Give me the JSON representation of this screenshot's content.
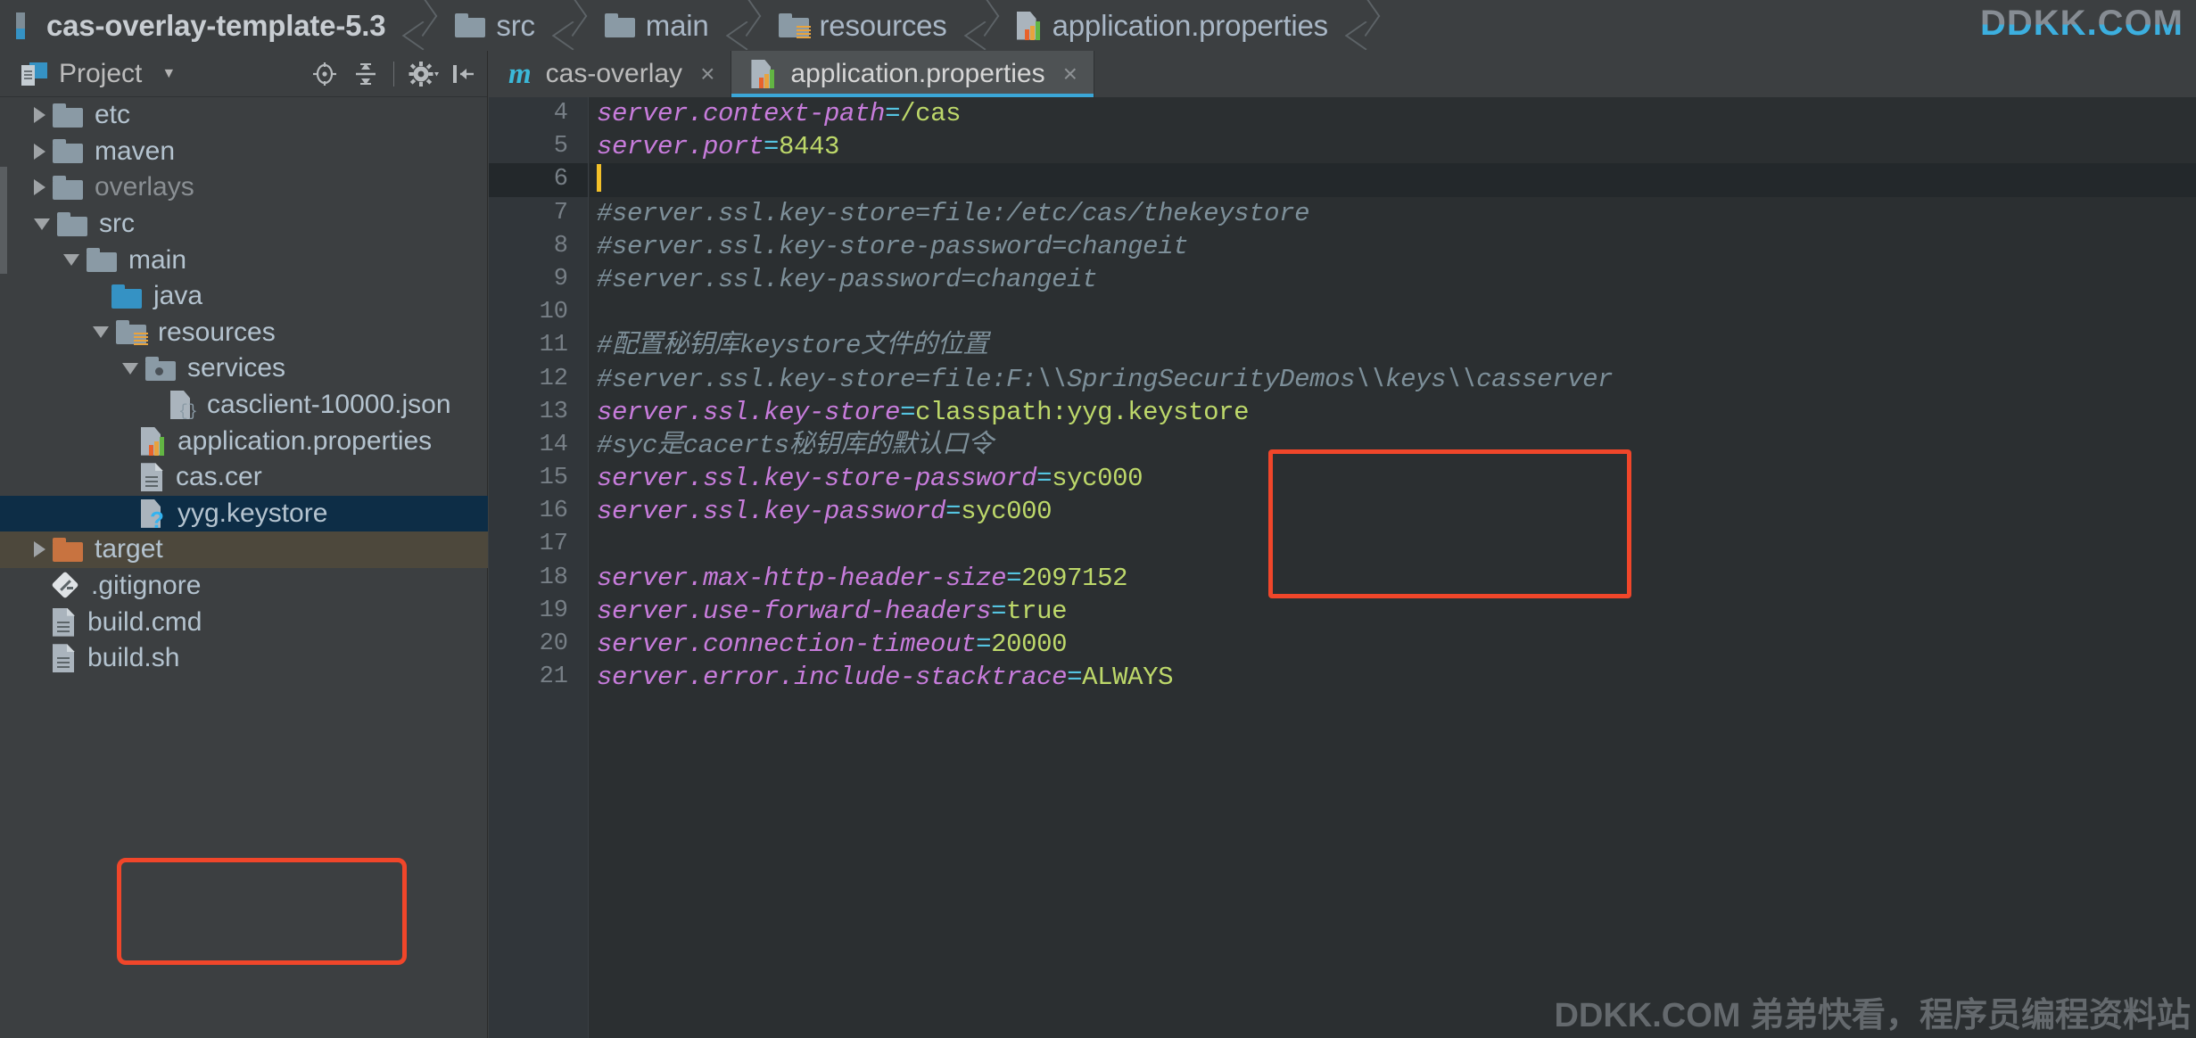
{
  "breadcrumb": {
    "items": [
      {
        "label": "cas-overlay-template-5.3",
        "icon": "module-icon"
      },
      {
        "label": "src",
        "icon": "folder-icon"
      },
      {
        "label": "main",
        "icon": "folder-icon"
      },
      {
        "label": "resources",
        "icon": "resources-folder-icon"
      },
      {
        "label": "application.properties",
        "icon": "properties-file-icon"
      }
    ]
  },
  "watermarks": {
    "top_right": "DDKK.COM",
    "bottom_right": "DDKK.COM 弟弟快看，程序员编程资料站"
  },
  "project_panel": {
    "title": "Project",
    "caret": "▼",
    "tools": [
      {
        "name": "locate-target-icon",
        "tooltip": "Select Opened File"
      },
      {
        "name": "collapse-all-icon",
        "tooltip": "Collapse All"
      },
      {
        "name": "settings-gear-icon",
        "tooltip": "Settings"
      },
      {
        "name": "hide-panel-icon",
        "tooltip": "Hide"
      }
    ],
    "tree": [
      {
        "label": "etc",
        "indent": 0,
        "arrow": "right",
        "icon": "folder-icon",
        "state": "normal"
      },
      {
        "label": "maven",
        "indent": 0,
        "arrow": "right",
        "icon": "folder-icon",
        "state": "normal"
      },
      {
        "label": "overlays",
        "indent": 0,
        "arrow": "right",
        "icon": "folder-icon",
        "state": "dim"
      },
      {
        "label": "src",
        "indent": 0,
        "arrow": "down",
        "icon": "folder-icon",
        "state": "normal"
      },
      {
        "label": "main",
        "indent": 1,
        "arrow": "down",
        "icon": "folder-icon",
        "state": "normal"
      },
      {
        "label": "java",
        "indent": 2,
        "arrow": "none",
        "icon": "source-folder-icon",
        "state": "normal"
      },
      {
        "label": "resources",
        "indent": 2,
        "arrow": "down",
        "icon": "resources-folder-icon",
        "state": "normal"
      },
      {
        "label": "services",
        "indent": 3,
        "arrow": "down",
        "icon": "services-folder-icon",
        "state": "normal"
      },
      {
        "label": "casclient-10000.json",
        "indent": 4,
        "arrow": "none",
        "icon": "json-file-icon",
        "state": "normal"
      },
      {
        "label": "application.properties",
        "indent": 3,
        "arrow": "none",
        "icon": "properties-file-icon",
        "state": "normal"
      },
      {
        "label": "cas.cer",
        "indent": 3,
        "arrow": "none",
        "icon": "text-file-icon",
        "state": "normal"
      },
      {
        "label": "yyg.keystore",
        "indent": 3,
        "arrow": "none",
        "icon": "unknown-file-icon",
        "state": "selected"
      },
      {
        "label": "target",
        "indent": 0,
        "arrow": "right",
        "icon": "excluded-folder-icon",
        "state": "hover"
      },
      {
        "label": ".gitignore",
        "indent": 0,
        "arrow": "none",
        "icon": "git-file-icon",
        "state": "normal"
      },
      {
        "label": "build.cmd",
        "indent": 0,
        "arrow": "none",
        "icon": "text-file-icon",
        "state": "normal"
      },
      {
        "label": "build.sh",
        "indent": 0,
        "arrow": "none",
        "icon": "text-file-icon",
        "state": "normal"
      }
    ]
  },
  "editor": {
    "tabs": [
      {
        "label": "cas-overlay",
        "icon": "maven-m-icon",
        "active": false,
        "close": "×"
      },
      {
        "label": "application.properties",
        "icon": "properties-file-icon",
        "active": true,
        "close": "×"
      }
    ],
    "first_line_number": 4,
    "caret_line": 6,
    "lines": [
      {
        "n": 4,
        "type": "prop",
        "key": "server.context-path",
        "eq": "=",
        "value": "/cas"
      },
      {
        "n": 5,
        "type": "prop",
        "key": "server.port",
        "eq": "=",
        "value": "8443"
      },
      {
        "n": 6,
        "type": "caret",
        "text": ""
      },
      {
        "n": 7,
        "type": "comment",
        "text": "#server.ssl.key-store=file:/etc/cas/thekeystore"
      },
      {
        "n": 8,
        "type": "comment",
        "text": "#server.ssl.key-store-password=changeit"
      },
      {
        "n": 9,
        "type": "comment",
        "text": "#server.ssl.key-password=changeit"
      },
      {
        "n": 10,
        "type": "blank",
        "text": ""
      },
      {
        "n": 11,
        "type": "comment",
        "text": "#配置秘钥库keystore文件的位置"
      },
      {
        "n": 12,
        "type": "comment",
        "text": "#server.ssl.key-store=file:F:\\\\SpringSecurityDemos\\\\keys\\\\casserver"
      },
      {
        "n": 13,
        "type": "prop",
        "key": "server.ssl.key-store",
        "eq": "=",
        "value": "classpath:yyg.keystore"
      },
      {
        "n": 14,
        "type": "comment",
        "text": "#syc是cacerts秘钥库的默认口令"
      },
      {
        "n": 15,
        "type": "prop",
        "key": "server.ssl.key-store-password",
        "eq": "=",
        "value": "syc000"
      },
      {
        "n": 16,
        "type": "prop",
        "key": "server.ssl.key-password",
        "eq": "=",
        "value": "syc000"
      },
      {
        "n": 17,
        "type": "blank",
        "text": ""
      },
      {
        "n": 18,
        "type": "prop",
        "key": "server.max-http-header-size",
        "eq": "=",
        "value": "2097152"
      },
      {
        "n": 19,
        "type": "prop",
        "key": "server.use-forward-headers",
        "eq": "=",
        "value": "true"
      },
      {
        "n": 20,
        "type": "prop",
        "key": "server.connection-timeout",
        "eq": "=",
        "value": "20000"
      },
      {
        "n": 21,
        "type": "prop",
        "key": "server.error.include-stacktrace",
        "eq": "=",
        "value": "ALWAYS"
      }
    ]
  },
  "annotations": {
    "sidebar_box_color": "#f0462a",
    "code_box_color": "#f0462a"
  },
  "colors": {
    "background": "#3c3f41",
    "editor_background": "#2b2f31",
    "accent": "#3ba7d8",
    "key": "#c77cdb",
    "value": "#bdd86a",
    "comment": "#7d8f99",
    "equals": "#55c4e0",
    "caret": "#f2c029",
    "selection": "#0d2d46"
  }
}
